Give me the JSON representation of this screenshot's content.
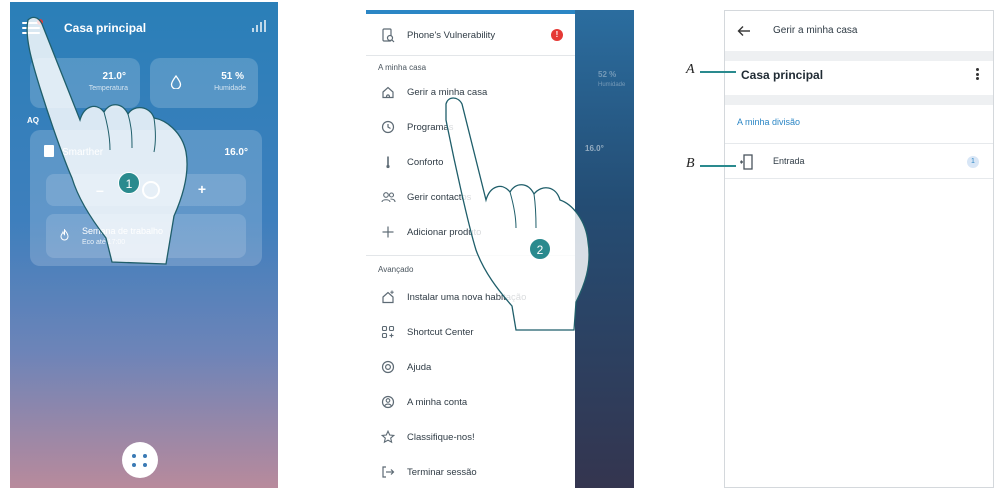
{
  "screen1": {
    "title": "Casa principal",
    "temperature": "21.0°",
    "temperature_label": "Temperatura",
    "humidity": "51 %",
    "humidity_label": "Humidade",
    "section": "AQ",
    "thermostat_name": "Smarther",
    "thermostat_temp": "16.0°",
    "minus": "–",
    "plus": "+",
    "program_title": "Semana de trabalho",
    "program_sub": "Eco até 17:00"
  },
  "screen2": {
    "vulnerability": "Phone's Vulnerability",
    "vulnerability_badge": "!",
    "section_home": "A minha casa",
    "items_home": [
      {
        "label": "Gerir a minha casa",
        "icon": "home-icon"
      },
      {
        "label": "Programas",
        "icon": "clock-icon"
      },
      {
        "label": "Conforto",
        "icon": "thermometer-icon"
      },
      {
        "label": "Gerir contactos",
        "icon": "users-icon"
      },
      {
        "label": "Adicionar produto",
        "icon": "plus-icon"
      }
    ],
    "section_advanced": "Avançado",
    "items_advanced": [
      {
        "label": "Instalar uma nova habitação",
        "icon": "new-home-icon"
      },
      {
        "label": "Shortcut Center",
        "icon": "shortcut-icon"
      },
      {
        "label": "Ajuda",
        "icon": "help-icon"
      },
      {
        "label": "A minha conta",
        "icon": "account-icon"
      },
      {
        "label": "Classifique-nos!",
        "icon": "star-icon"
      },
      {
        "label": "Terminar sessão",
        "icon": "logout-icon"
      }
    ],
    "bg_humidity": "52 %",
    "bg_humidity_label": "Humidade",
    "bg_temp": "16.0°"
  },
  "screen3": {
    "title": "Gerir a minha casa",
    "home_name": "Casa principal",
    "section": "A minha divisão",
    "room": "Entrada",
    "room_count": "1"
  },
  "callouts": {
    "a": "A",
    "b": "B"
  },
  "steps": {
    "one": "1",
    "two": "2"
  },
  "colors": {
    "accent": "#2a8a8e",
    "link": "#2b86c5",
    "badge": "#e53935"
  }
}
